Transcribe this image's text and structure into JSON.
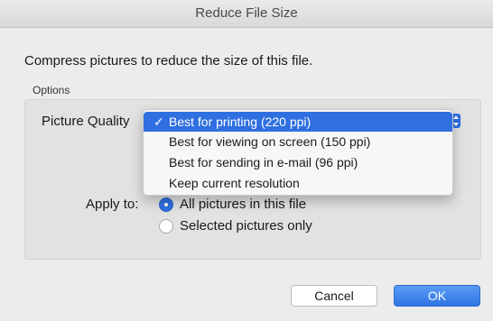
{
  "window": {
    "title": "Reduce File Size"
  },
  "dialog": {
    "intro_text": "Compress pictures to reduce the size of this file.",
    "options_label": "Options",
    "picture_quality": {
      "label": "Picture Quality",
      "options": [
        {
          "label": "Best for printing (220 ppi)",
          "selected": true
        },
        {
          "label": "Best for viewing on screen (150 ppi)",
          "selected": false
        },
        {
          "label": "Best for sending in e-mail (96 ppi)",
          "selected": false
        },
        {
          "label": "Keep current resolution",
          "selected": false
        }
      ],
      "check_glyph": "✓"
    },
    "apply_to": {
      "label": "Apply to:",
      "options": [
        {
          "label": "All pictures in this file",
          "selected": true
        },
        {
          "label": "Selected pictures only",
          "selected": false
        }
      ]
    },
    "buttons": {
      "cancel_label": "Cancel",
      "ok_label": "OK"
    }
  },
  "colors": {
    "accent": "#2f6fe0",
    "dialog_bg": "#ececec"
  }
}
